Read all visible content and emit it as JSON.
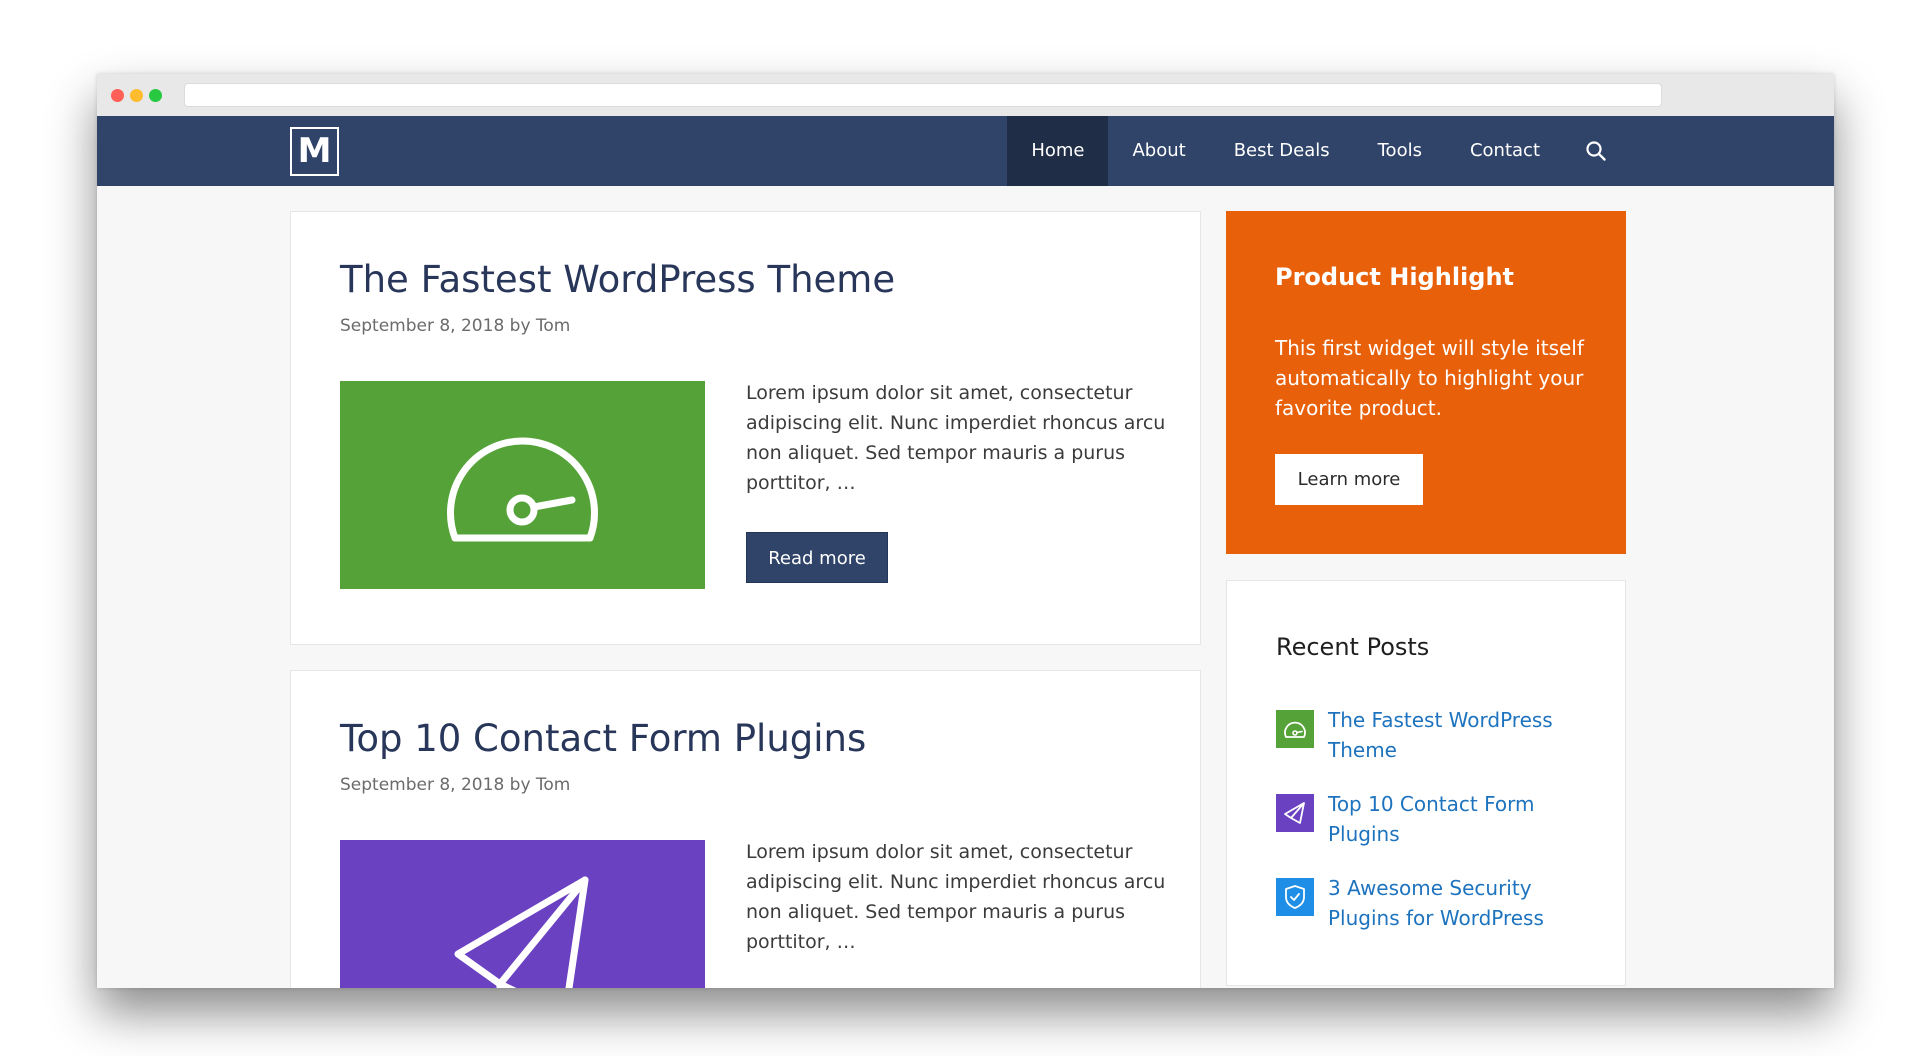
{
  "site": {
    "logo_letter": "M"
  },
  "nav": {
    "items": [
      {
        "label": "Home",
        "active": true
      },
      {
        "label": "About"
      },
      {
        "label": "Best Deals"
      },
      {
        "label": "Tools"
      },
      {
        "label": "Contact"
      }
    ],
    "search_icon": "search-icon"
  },
  "posts": [
    {
      "title": "The Fastest WordPress Theme",
      "meta": "September 8, 2018 by Tom",
      "thumb_icon": "speedometer-icon",
      "thumb_color": "#55a338",
      "excerpt": "Lorem ipsum dolor sit amet, consectetur adipiscing elit. Nunc imperdiet rhoncus arcu non aliquet. Sed tempor mauris a purus porttitor, …",
      "read_more": "Read more"
    },
    {
      "title": "Top 10 Contact Form Plugins",
      "meta": "September 8, 2018 by Tom",
      "thumb_icon": "paper-plane-icon",
      "thumb_color": "#6941c1",
      "excerpt": "Lorem ipsum dolor sit amet, consectetur adipiscing elit. Nunc imperdiet rhoncus arcu non aliquet. Sed tempor mauris a purus porttitor, …"
    }
  ],
  "sidebar": {
    "highlight": {
      "title": "Product Highlight",
      "text": "This first widget will style itself automatically to highlight your favorite product.",
      "button": "Learn more",
      "color": "#e8610a"
    },
    "recent": {
      "title": "Recent Posts",
      "items": [
        {
          "label": "The Fastest WordPress Theme",
          "icon": "speedometer-icon",
          "color": "#55a338"
        },
        {
          "label": "Top 10 Contact Form Plugins",
          "icon": "paper-plane-icon",
          "color": "#6941c1"
        },
        {
          "label": "3 Awesome Security Plugins for WordPress",
          "icon": "shield-icon",
          "color": "#1e8ee6"
        }
      ]
    }
  },
  "colors": {
    "header": "#304469",
    "link": "#1e73be",
    "title": "#28365a"
  }
}
